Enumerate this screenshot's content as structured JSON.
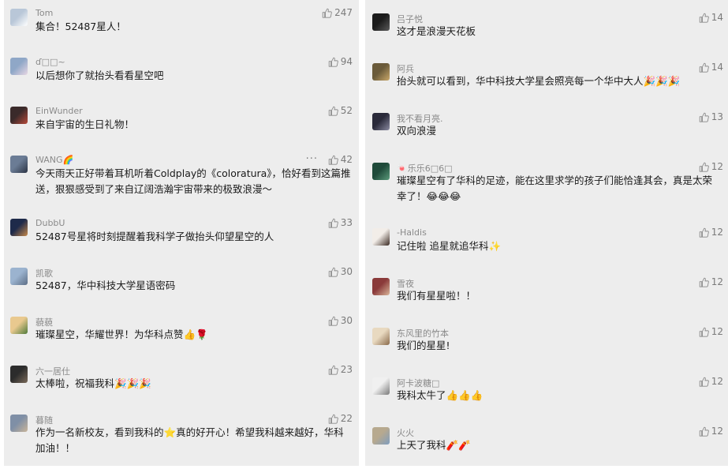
{
  "colors": {
    "panel_bg": "#ededed",
    "nickname": "#8a8a8a",
    "text": "#1a1a1a",
    "like": "#7a7a7a"
  },
  "left_comments": [
    {
      "nickname": "Tom",
      "text": "集合！52487星人！",
      "likes": "247",
      "avatar": [
        "#b9c7d8",
        "#ffffff"
      ]
    },
    {
      "nickname": "ɗ□□~",
      "text": "以后想你了就抬头看看星空吧",
      "likes": "94",
      "avatar": [
        "#8fa7c7",
        "#e8d7e4"
      ]
    },
    {
      "nickname": "EinWunder",
      "text": "来自宇宙的生日礼物！",
      "likes": "52",
      "avatar": [
        "#3a2a2a",
        "#b84a3a"
      ]
    },
    {
      "nickname": "WANG🌈",
      "text": "今天雨天正好带着耳机听着Coldplay的《coloratura》，恰好看到这篇推送，狠狠感受到了来自辽阔浩瀚宇宙带来的极致浪漫～",
      "likes": "42",
      "more": "···",
      "avatar": [
        "#6b7c95",
        "#2c3445"
      ]
    },
    {
      "nickname": "DubbU",
      "text": "52487号星将时刻提醒着我科学子做抬头仰望星空的人",
      "likes": "33",
      "avatar": [
        "#1e2a4a",
        "#c7894a"
      ]
    },
    {
      "nickname": "凯歌",
      "text": "52487，华中科技大学星语密码",
      "likes": "30",
      "avatar": [
        "#9bb3cf",
        "#5d6e86"
      ]
    },
    {
      "nickname": "藐藐",
      "text": "璀璨星空，华耀世界！为华科点赞👍🌹",
      "likes": "30",
      "avatar": [
        "#e9c98f",
        "#4f7a3a"
      ]
    },
    {
      "nickname": "六一居仕",
      "text": "太棒啦，祝福我科🎉🎉🎉",
      "likes": "23",
      "avatar": [
        "#2c2c2c",
        "#7a6a5a"
      ]
    },
    {
      "nickname": "暮随",
      "text": "作为一名新校友，看到我科的⭐真的好开心！希望我科越来越好，华科加油！！",
      "likes": "22",
      "avatar": [
        "#7f8fa6",
        "#c9b59a"
      ]
    }
  ],
  "right_comments": [
    {
      "nickname": "吕子悦",
      "text": "这才是浪漫天花板",
      "likes": "14",
      "avatar": [
        "#1b1b1b",
        "#5a5a5a"
      ]
    },
    {
      "nickname": "阿兵",
      "text": "抬头就可以看到，华中科技大学星会照亮每一个华中大人🎉🎉🎉",
      "likes": "14",
      "avatar": [
        "#6a5a3a",
        "#c9a86a"
      ]
    },
    {
      "nickname": "我不看月亮.",
      "text": "双向浪漫",
      "likes": "13",
      "avatar": [
        "#2a2a3a",
        "#8a8aa0"
      ]
    },
    {
      "nickname": "🍬乐乐6□6□",
      "text": "璀璨星空有了华科的足迹，能在这里求学的孩子们能恰逢其会，真是太荣幸了！😂😂😂",
      "likes": "12",
      "avatar": [
        "#1f4a3a",
        "#5a9a7a"
      ]
    },
    {
      "nickname": "-Haldis",
      "text": "记住啦 追星就追华科✨",
      "likes": "12",
      "avatar": [
        "#f2ede8",
        "#3a2a22"
      ]
    },
    {
      "nickname": "雪夜",
      "text": "我们有星星啦！！",
      "likes": "12",
      "avatar": [
        "#8a3a3a",
        "#d9b59a"
      ]
    },
    {
      "nickname": "东风里的竹本",
      "text": "我们的星星!",
      "likes": "12",
      "avatar": [
        "#e8d9c0",
        "#8a6a4a"
      ]
    },
    {
      "nickname": "阿卡波糖□",
      "text": "我科太牛了👍👍👍",
      "likes": "12",
      "avatar": [
        "#f0f0f0",
        "#7a7a7a"
      ]
    },
    {
      "nickname": "火火",
      "text": "上天了我科🧨🧨",
      "likes": "12",
      "avatar": [
        "#b7a98f",
        "#7f9dbf"
      ]
    }
  ]
}
